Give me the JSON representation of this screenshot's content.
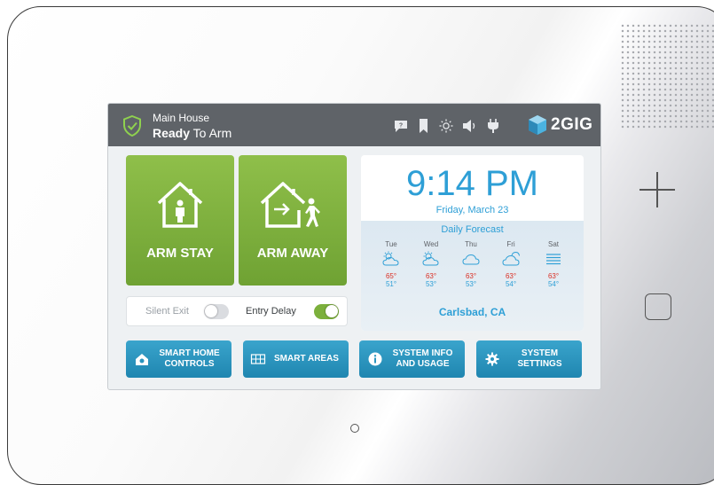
{
  "status_bar": {
    "location": "Main House",
    "state_bold": "Ready",
    "state_rest": " To Arm",
    "icons": [
      "chat-icon",
      "bookmark-icon",
      "brightness-icon",
      "volume-icon",
      "power-plug-icon"
    ],
    "brand": "2GIG"
  },
  "arm": {
    "stay_label": "ARM STAY",
    "away_label": "ARM AWAY"
  },
  "toggles": {
    "silent_exit_label": "Silent Exit",
    "silent_exit_on": false,
    "entry_delay_label": "Entry Delay",
    "entry_delay_on": true
  },
  "weather": {
    "time": "9:14 PM",
    "date": "Friday, March 23",
    "forecast_title": "Daily Forecast",
    "days": [
      {
        "name": "Tue",
        "icon": "partly-sunny-icon",
        "hi": "65°",
        "lo": "51°"
      },
      {
        "name": "Wed",
        "icon": "partly-sunny-icon",
        "hi": "63°",
        "lo": "53°"
      },
      {
        "name": "Thu",
        "icon": "cloud-icon",
        "hi": "63°",
        "lo": "53°"
      },
      {
        "name": "Fri",
        "icon": "partly-cloudy-icon",
        "hi": "63°",
        "lo": "54°"
      },
      {
        "name": "Sat",
        "icon": "fog-icon",
        "hi": "63°",
        "lo": "54°"
      }
    ],
    "city": "Carlsbad, CA"
  },
  "buttons": {
    "smart_home": "SMART HOME\nCONTROLS",
    "smart_areas": "SMART AREAS",
    "system_info": "SYSTEM INFO\nAND USAGE",
    "system_settings": "SYSTEM\nSETTINGS"
  },
  "colors": {
    "status_bar": "#5f6368",
    "arm_green": "#7cb03c",
    "accent_blue": "#2e9fd6",
    "button_blue": "#2a95bf",
    "toggle_on": "#7cb03c"
  }
}
